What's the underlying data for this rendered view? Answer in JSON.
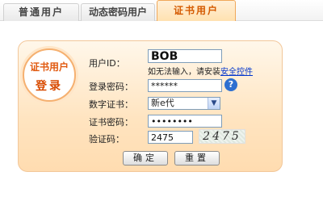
{
  "tabs": [
    {
      "label": "普通用户"
    },
    {
      "label": "动态密码用户"
    },
    {
      "label": "证书用户"
    }
  ],
  "badge": {
    "line1": "证书用户",
    "line2": "登录"
  },
  "form": {
    "userid_label": "用户ID：",
    "userid_value": "BOB",
    "hint_text": "如无法输入，请安装",
    "hint_link": "安全控件",
    "login_password_label": "登录密码：",
    "login_password_value": "******",
    "cert_label": "数字证书：",
    "cert_selected": "新e代",
    "cert_password_label": "证书密码：",
    "cert_password_value": "........",
    "captcha_label": "验证码：",
    "captcha_value": "2475",
    "captcha_image_text": "2475"
  },
  "buttons": {
    "confirm": "确定",
    "reset": "重置"
  },
  "colors": {
    "accent": "#e15a10",
    "panel": "#ffe4c0",
    "border": "#f2c79a"
  },
  "icons": {
    "help": "help-icon",
    "dropdown": "chevron-down-icon"
  }
}
